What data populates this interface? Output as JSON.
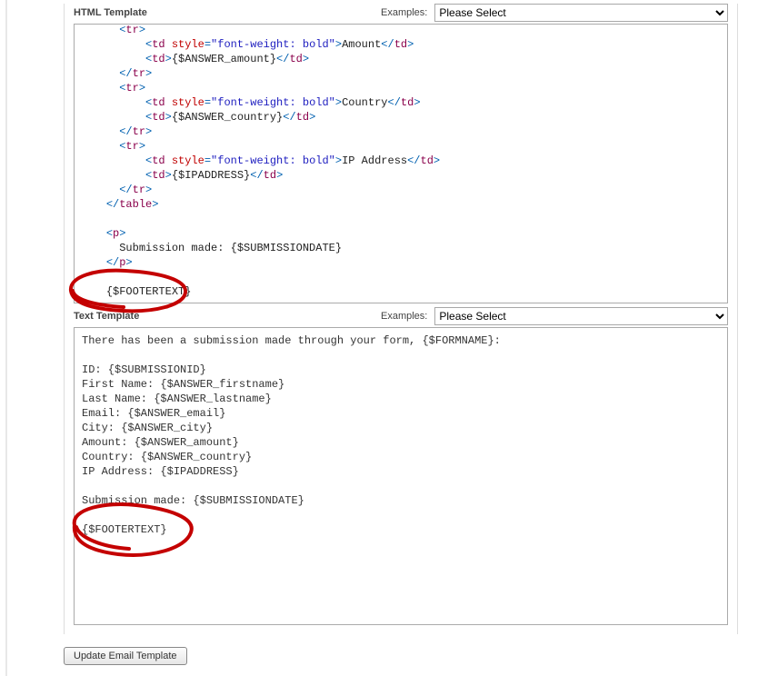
{
  "html_section": {
    "title": "HTML Template",
    "examples_label": "Examples:",
    "select_placeholder": "Please Select",
    "code_lines": [
      {
        "indent": 3,
        "tokens": [
          {
            "c": "t-ang",
            "t": "</"
          },
          {
            "c": "t-tag",
            "t": "tr"
          },
          {
            "c": "t-ang",
            "t": ">"
          }
        ]
      },
      {
        "indent": 3,
        "tokens": [
          {
            "c": "t-ang",
            "t": "<"
          },
          {
            "c": "t-tag",
            "t": "tr"
          },
          {
            "c": "t-ang",
            "t": ">"
          }
        ]
      },
      {
        "indent": 5,
        "tokens": [
          {
            "c": "t-ang",
            "t": "<"
          },
          {
            "c": "t-tag",
            "t": "td"
          },
          {
            "c": "",
            "t": " "
          },
          {
            "c": "t-attr",
            "t": "style"
          },
          {
            "c": "t-ang",
            "t": "="
          },
          {
            "c": "t-val",
            "t": "\"font-weight: bold\""
          },
          {
            "c": "t-ang",
            "t": ">"
          },
          {
            "c": "t-txt",
            "t": "Amount"
          },
          {
            "c": "t-ang",
            "t": "</"
          },
          {
            "c": "t-tag",
            "t": "td"
          },
          {
            "c": "t-ang",
            "t": ">"
          }
        ]
      },
      {
        "indent": 5,
        "tokens": [
          {
            "c": "t-ang",
            "t": "<"
          },
          {
            "c": "t-tag",
            "t": "td"
          },
          {
            "c": "t-ang",
            "t": ">"
          },
          {
            "c": "t-txt",
            "t": "{$ANSWER_amount}"
          },
          {
            "c": "t-ang",
            "t": "</"
          },
          {
            "c": "t-tag",
            "t": "td"
          },
          {
            "c": "t-ang",
            "t": ">"
          }
        ]
      },
      {
        "indent": 3,
        "tokens": [
          {
            "c": "t-ang",
            "t": "</"
          },
          {
            "c": "t-tag",
            "t": "tr"
          },
          {
            "c": "t-ang",
            "t": ">"
          }
        ]
      },
      {
        "indent": 3,
        "tokens": [
          {
            "c": "t-ang",
            "t": "<"
          },
          {
            "c": "t-tag",
            "t": "tr"
          },
          {
            "c": "t-ang",
            "t": ">"
          }
        ]
      },
      {
        "indent": 5,
        "tokens": [
          {
            "c": "t-ang",
            "t": "<"
          },
          {
            "c": "t-tag",
            "t": "td"
          },
          {
            "c": "",
            "t": " "
          },
          {
            "c": "t-attr",
            "t": "style"
          },
          {
            "c": "t-ang",
            "t": "="
          },
          {
            "c": "t-val",
            "t": "\"font-weight: bold\""
          },
          {
            "c": "t-ang",
            "t": ">"
          },
          {
            "c": "t-txt",
            "t": "Country"
          },
          {
            "c": "t-ang",
            "t": "</"
          },
          {
            "c": "t-tag",
            "t": "td"
          },
          {
            "c": "t-ang",
            "t": ">"
          }
        ]
      },
      {
        "indent": 5,
        "tokens": [
          {
            "c": "t-ang",
            "t": "<"
          },
          {
            "c": "t-tag",
            "t": "td"
          },
          {
            "c": "t-ang",
            "t": ">"
          },
          {
            "c": "t-txt",
            "t": "{$ANSWER_country}"
          },
          {
            "c": "t-ang",
            "t": "</"
          },
          {
            "c": "t-tag",
            "t": "td"
          },
          {
            "c": "t-ang",
            "t": ">"
          }
        ]
      },
      {
        "indent": 3,
        "tokens": [
          {
            "c": "t-ang",
            "t": "</"
          },
          {
            "c": "t-tag",
            "t": "tr"
          },
          {
            "c": "t-ang",
            "t": ">"
          }
        ]
      },
      {
        "indent": 3,
        "tokens": [
          {
            "c": "t-ang",
            "t": "<"
          },
          {
            "c": "t-tag",
            "t": "tr"
          },
          {
            "c": "t-ang",
            "t": ">"
          }
        ]
      },
      {
        "indent": 5,
        "tokens": [
          {
            "c": "t-ang",
            "t": "<"
          },
          {
            "c": "t-tag",
            "t": "td"
          },
          {
            "c": "",
            "t": " "
          },
          {
            "c": "t-attr",
            "t": "style"
          },
          {
            "c": "t-ang",
            "t": "="
          },
          {
            "c": "t-val",
            "t": "\"font-weight: bold\""
          },
          {
            "c": "t-ang",
            "t": ">"
          },
          {
            "c": "t-txt",
            "t": "IP Address"
          },
          {
            "c": "t-ang",
            "t": "</"
          },
          {
            "c": "t-tag",
            "t": "td"
          },
          {
            "c": "t-ang",
            "t": ">"
          }
        ]
      },
      {
        "indent": 5,
        "tokens": [
          {
            "c": "t-ang",
            "t": "<"
          },
          {
            "c": "t-tag",
            "t": "td"
          },
          {
            "c": "t-ang",
            "t": ">"
          },
          {
            "c": "t-txt",
            "t": "{$IPADDRESS}"
          },
          {
            "c": "t-ang",
            "t": "</"
          },
          {
            "c": "t-tag",
            "t": "td"
          },
          {
            "c": "t-ang",
            "t": ">"
          }
        ]
      },
      {
        "indent": 3,
        "tokens": [
          {
            "c": "t-ang",
            "t": "</"
          },
          {
            "c": "t-tag",
            "t": "tr"
          },
          {
            "c": "t-ang",
            "t": ">"
          }
        ]
      },
      {
        "indent": 2,
        "tokens": [
          {
            "c": "t-ang",
            "t": "</"
          },
          {
            "c": "t-tag",
            "t": "table"
          },
          {
            "c": "t-ang",
            "t": ">"
          }
        ]
      },
      {
        "indent": 2,
        "tokens": [
          {
            "c": "",
            "t": ""
          }
        ]
      },
      {
        "indent": 2,
        "tokens": [
          {
            "c": "t-ang",
            "t": "<"
          },
          {
            "c": "t-tag",
            "t": "p"
          },
          {
            "c": "t-ang",
            "t": ">"
          }
        ]
      },
      {
        "indent": 3,
        "tokens": [
          {
            "c": "t-txt",
            "t": "Submission made: {$SUBMISSIONDATE}"
          }
        ]
      },
      {
        "indent": 2,
        "tokens": [
          {
            "c": "t-ang",
            "t": "</"
          },
          {
            "c": "t-tag",
            "t": "p"
          },
          {
            "c": "t-ang",
            "t": ">"
          }
        ]
      },
      {
        "indent": 2,
        "tokens": [
          {
            "c": "",
            "t": ""
          }
        ]
      },
      {
        "indent": 2,
        "tokens": [
          {
            "c": "t-txt",
            "t": "{$FOOTERTEXT}"
          }
        ]
      }
    ]
  },
  "text_section": {
    "title": "Text Template",
    "examples_label": "Examples:",
    "select_placeholder": "Please Select",
    "body": "There has been a submission made through your form, {$FORMNAME}:\n\nID: {$SUBMISSIONID}\nFirst Name: {$ANSWER_firstname}\nLast Name: {$ANSWER_lastname}\nEmail: {$ANSWER_email}\nCity: {$ANSWER_city}\nAmount: {$ANSWER_amount}\nCountry: {$ANSWER_country}\nIP Address: {$IPADDRESS}\n\nSubmission made: {$SUBMISSIONDATE}\n\n{$FOOTERTEXT}"
  },
  "button": {
    "update_label": "Update Email Template"
  }
}
